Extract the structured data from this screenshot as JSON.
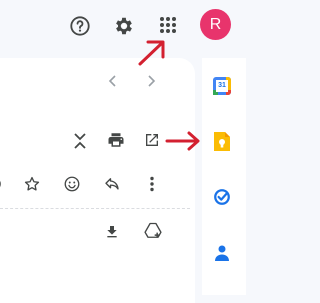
{
  "header": {
    "avatar_initial": "R",
    "avatar_color": "#e8346c",
    "support_icon": "help-icon",
    "settings_icon": "gear-icon",
    "apps_icon": "apps-grid-icon"
  },
  "side_panel": {
    "calendar_day": "31",
    "items": [
      "calendar-icon",
      "keep-icon",
      "tasks-icon",
      "contacts-icon"
    ]
  },
  "toolbar": {
    "pager_icons": [
      "chevron-left-icon",
      "chevron-right-icon"
    ],
    "message_actions": [
      "collapse-icon",
      "print-icon",
      "open-new-window-icon"
    ],
    "reply_actions": [
      "star-icon",
      "emoji-icon",
      "reply-icon",
      "more-vert-icon"
    ],
    "attachment_actions": [
      "download-icon",
      "add-to-drive-icon"
    ]
  },
  "colors": {
    "annotation_arrow": "#d32030",
    "icon": "#444746"
  }
}
